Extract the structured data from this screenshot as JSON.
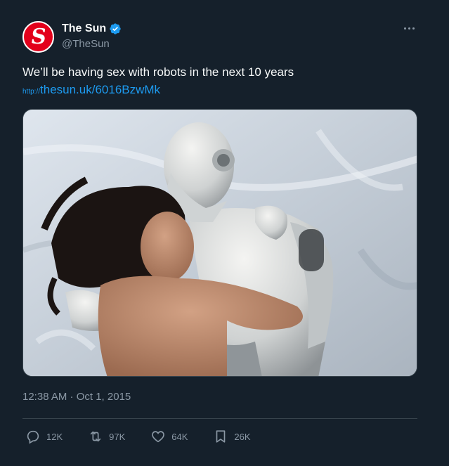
{
  "author": {
    "avatar_letter": "S",
    "display_name": "The Sun",
    "handle": "@TheSun",
    "verified": true
  },
  "tweet": {
    "text": "We’ll be having sex with robots in the next 10 years",
    "link_prefix": "http://",
    "link_text": "thesun.uk/6016BzwMk",
    "timestamp": "12:38 AM · Oct 1, 2015"
  },
  "actions": {
    "replies": "12K",
    "retweets": "97K",
    "likes": "64K",
    "bookmarks": "26K"
  },
  "icons": {
    "more": "more-horizontal-icon",
    "verified": "verified-badge-icon",
    "reply": "reply-icon",
    "retweet": "retweet-icon",
    "like": "heart-icon",
    "bookmark": "bookmark-icon"
  },
  "colors": {
    "background": "#15202b",
    "text_primary": "#f7f9f9",
    "text_secondary": "#8b98a5",
    "link": "#1d9bf0",
    "divider": "#38444d",
    "avatar": "#e3001b"
  }
}
